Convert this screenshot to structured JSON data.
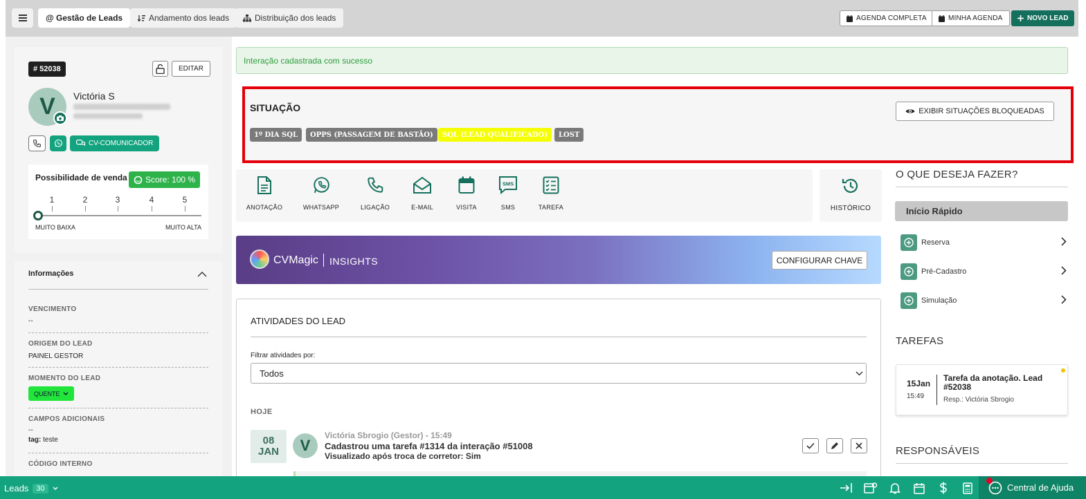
{
  "topbar": {
    "menu_icon": "menu-icon",
    "tabs": [
      {
        "label": "@ Gestão de Leads",
        "active": true
      },
      {
        "label": "Andamento dos leads",
        "icon": "sort-icon"
      },
      {
        "label": "Distribuição dos leads",
        "icon": "sitemap-icon"
      }
    ],
    "agenda_completa": "AGENDA COMPLETA",
    "minha_agenda": "MINHA AGENDA",
    "novo_lead": "NOVO LEAD"
  },
  "lead": {
    "id": "# 52038",
    "edit_label": "EDITAR",
    "avatar_letter": "V",
    "name": "Victória S",
    "cv_comunicador": "CV-COMUNICADOR",
    "possibilidade_label": "Possibilidade de venda",
    "score_label": "Score: 100 %",
    "scale": [
      "1",
      "2",
      "3",
      "4",
      "5"
    ],
    "scale_min": "MUITO BAIXA",
    "scale_max": "MUITO ALTA",
    "slider_value": 0
  },
  "info": {
    "title": "Informações",
    "fields": [
      {
        "label": "VENCIMENTO",
        "value": "--"
      },
      {
        "label": "ORIGEM DO LEAD",
        "value": "PAINEL GESTOR"
      },
      {
        "label": "MOMENTO DO LEAD",
        "value": "QUENTE"
      },
      {
        "label": "CAMPOS ADICIONAIS",
        "value": "--",
        "tag_label": "tag:",
        "tag_value": "teste"
      },
      {
        "label": "CÓDIGO INTERNO"
      }
    ]
  },
  "alert": {
    "text": "Interação cadastrada com sucesso"
  },
  "situacao": {
    "title": "SITUAÇÃO",
    "tags": [
      {
        "label": "1º DIA SQL",
        "bg": "#7a7a7a",
        "color": "#ffffff"
      },
      {
        "label": "OPPS (PASSAGEM DE BASTÃO)",
        "bg": "#7a7a7a",
        "color": "#ffffff"
      },
      {
        "label": "SQL (LEAD QUALIFICADO)",
        "bg": "#f5ff00",
        "color": "#ffffff"
      },
      {
        "label": "LOST",
        "bg": "#7a7a7a",
        "color": "#ffffff"
      }
    ],
    "exibir_label": "EXIBIR SITUAÇÕES BLOQUEADAS"
  },
  "actions": [
    {
      "label": "ANOTAÇÃO",
      "icon": "note-icon"
    },
    {
      "label": "WHATSAPP",
      "icon": "whatsapp-icon"
    },
    {
      "label": "LIGAÇÃO",
      "icon": "phone-icon"
    },
    {
      "label": "E-MAIL",
      "icon": "email-icon"
    },
    {
      "label": "VISITA",
      "icon": "calendar-icon"
    },
    {
      "label": "SMS",
      "icon": "sms-icon"
    },
    {
      "label": "TAREFA",
      "icon": "task-icon"
    }
  ],
  "historico": "HISTÓRICO",
  "cvmagic": {
    "name": "CVMagic",
    "sub": "INSIGHTS",
    "button": "CONFIGURAR CHAVE"
  },
  "atividades": {
    "title": "ATIVIDADES DO LEAD",
    "filter_label": "Filtrar atividades por:",
    "filter_value": "Todos",
    "group": "HOJE",
    "items": [
      {
        "day": "08",
        "month": "JAN",
        "avatar": "V",
        "author": "Victória Sbrogio (Gestor) - 15:49",
        "line1": "Cadastrou uma tarefa #1314 da interação #51008",
        "line2": "Visualizado após troca de corretor:  Sim"
      }
    ]
  },
  "right": {
    "o_que_title": "O QUE DESEJA FAZER?",
    "inicio_rapido": "Início Rápido",
    "quick": [
      "Reserva",
      "Pré-Cadastro",
      "Simulação"
    ],
    "tarefas_title": "TAREFAS",
    "task": {
      "day": "15Jan",
      "time": "15:49",
      "title": "Tarefa da anotação. Lead #52038",
      "resp": "Resp.: Victória Sbrogio"
    },
    "responsaveis_title": "RESPONSÁVEIS"
  },
  "bottombar": {
    "leads_label": "Leads",
    "leads_count": "30",
    "help_label": "Central de Ajuda"
  },
  "colors": {
    "primary_green": "#14705c",
    "accent_green": "#14a37f",
    "highlight_red": "#e4000a"
  }
}
